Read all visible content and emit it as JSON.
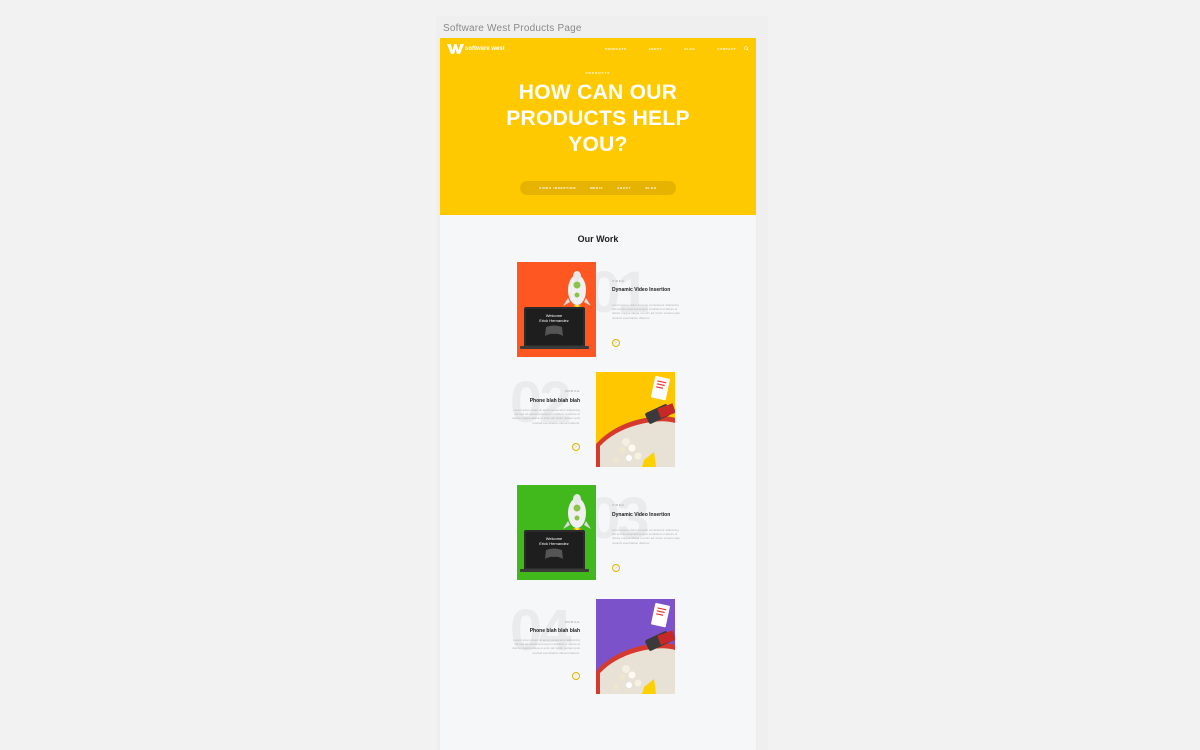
{
  "artboard": {
    "label": "Software West Products Page"
  },
  "header": {
    "logo_text": "software west",
    "nav": [
      "PRODUCTS",
      "ABOUT",
      "BLOG",
      "CONTACT"
    ],
    "search_icon": "search-icon"
  },
  "hero": {
    "eyebrow": "PRODUCTS",
    "headline_lines": [
      "HOW CAN OUR",
      "PRODUCTS HELP",
      "YOU?"
    ],
    "pill_nav": [
      "VIDEO INSERTION",
      "MEDIA",
      "ABOUT",
      "BLOG"
    ],
    "background_color": "#ffc900"
  },
  "work": {
    "title": "Our Work",
    "cards": [
      {
        "number": "01",
        "tag": "VIDEO",
        "title": "Dynamic Video Insertion",
        "desc": "Lorem ipsum dolor sit amet consectetur adipiscing elit sed do eiusmod tempor incididunt ut labore et dolore magna aliqua ut enim ad minim veniam quis nostrud exercitation ullamco.",
        "image_bg": "#ff5722",
        "image": "laptop-rocket"
      },
      {
        "number": "02",
        "tag": "MOBILE",
        "title": "Phone blah blah blah",
        "desc": "Lorem ipsum dolor sit amet consectetur adipiscing elit sed do eiusmod tempor incididunt ut labore et dolore magna aliqua ut enim ad minim veniam quis nostrud exercitation ullamco laboris.",
        "image_bg": "#ffc700",
        "image": "phone-popcorn"
      },
      {
        "number": "03",
        "tag": "VIDEO",
        "title": "Dynamic Video Insertion",
        "desc": "Lorem ipsum dolor sit amet consectetur adipiscing elit sed do eiusmod tempor incididunt ut labore et dolore magna aliqua ut enim ad minim veniam quis nostrud exercitation ullamco.",
        "image_bg": "#41b81b",
        "image": "laptop-rocket"
      },
      {
        "number": "04",
        "tag": "MOBILE",
        "title": "Phone blah blah blah",
        "desc": "Lorem ipsum dolor sit amet consectetur adipiscing elit sed do eiusmod tempor incididunt ut labore et dolore magna aliqua ut enim ad minim veniam quis nostrud exercitation ullamco laboris.",
        "image_bg": "#7b52c9",
        "image": "phone-popcorn"
      }
    ],
    "laptop_screen_text": [
      "Welcome",
      "Erick Hernandez"
    ],
    "arrow_icon": "arrow-right-icon"
  },
  "colors": {
    "accent": "#ffc900",
    "page_bg": "#f6f7f8"
  }
}
